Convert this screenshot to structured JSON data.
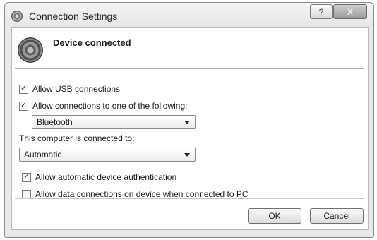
{
  "window": {
    "title": "Connection Settings",
    "help_glyph": "?",
    "close_glyph": "X"
  },
  "header": {
    "icon": "device-disc-icon",
    "title": "Device connected"
  },
  "options": {
    "allow_usb": {
      "label": "Allow USB connections",
      "checked": true
    },
    "allow_one_of": {
      "label": "Allow connections to one of the following:",
      "checked": true
    },
    "connection_type": {
      "selected": "Bluetooth"
    },
    "connected_to_label": "This computer is connected to:",
    "connected_to": {
      "selected": "Automatic"
    },
    "auto_auth": {
      "label": "Allow automatic device authentication",
      "checked": true
    },
    "data_on_device": {
      "label": "Allow data connections on device when connected to PC",
      "checked": false
    }
  },
  "buttons": {
    "ok": "OK",
    "cancel": "Cancel"
  },
  "check_glyph": "✓"
}
